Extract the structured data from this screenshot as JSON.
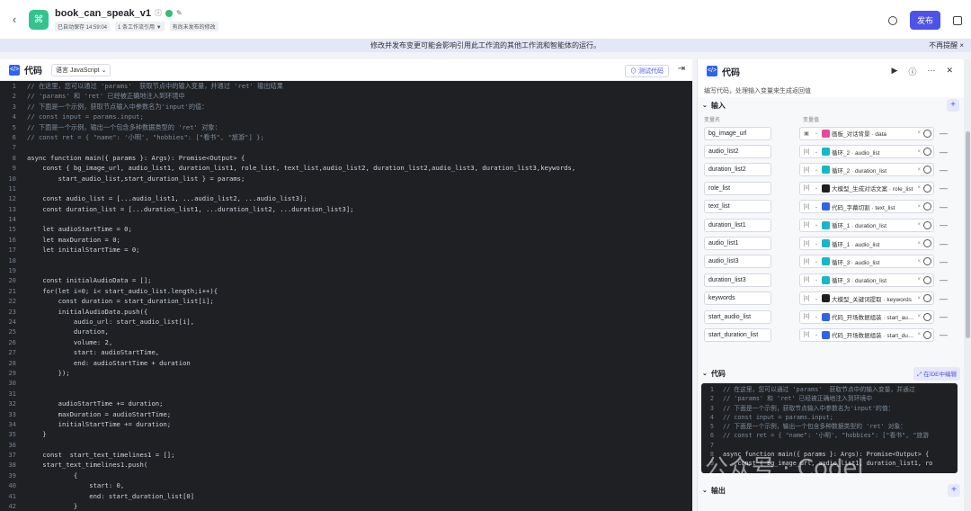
{
  "topbar": {
    "back_glyph": "‹",
    "title": "book_can_speak_v1",
    "autosave": "已自动保存 14:59:04",
    "refs": "1 条工作流引用 ▼",
    "unpublished": "有尚未发布的修改",
    "publish_label": "发布"
  },
  "notice": {
    "text": "修改并发布变更可能会影响引用此工作流的其他工作流和智能体的运行。",
    "dismiss": "不再提醒 ×"
  },
  "editor_panel": {
    "title": "代码",
    "language": "语言 JavaScript ⌄",
    "test_label": "⊙ 测试代码"
  },
  "code_lines": [
    {
      "n": "1",
      "t": "// 在这里，您可以通过 'params'  获取节点中的输入变量，并通过 'ret' 输出结果",
      "c": true
    },
    {
      "n": "2",
      "t": "// 'params' 和 'ret' 已经被正确地注入到环境中",
      "c": true
    },
    {
      "n": "3",
      "t": "// 下面是一个示例，获取节点输入中参数名为'input'的值：",
      "c": true
    },
    {
      "n": "4",
      "t": "// const input = params.input;",
      "c": true
    },
    {
      "n": "5",
      "t": "// 下面是一个示例，输出一个包含多种数据类型的 'ret' 对象：",
      "c": true
    },
    {
      "n": "6",
      "t": "// const ret = { \"name\": '小明', \"hobbies\": [\"看书\", \"旅游\"] };",
      "c": true
    },
    {
      "n": "7",
      "t": "",
      "c": false
    },
    {
      "n": "8",
      "t": "async function main({ params }: Args): Promise<Output> {",
      "c": false
    },
    {
      "n": "9",
      "t": "    const { bg_image_url, audio_list1, duration_list1, role_list, text_list,audio_list2, duration_list2,audio_list3, duration_list3,keywords,",
      "c": false
    },
    {
      "n": "10",
      "t": "        start_audio_list,start_duration_list } = params;",
      "c": false
    },
    {
      "n": "11",
      "t": "",
      "c": false
    },
    {
      "n": "12",
      "t": "    const audio_list = [...audio_list1, ...audio_list2, ...audio_list3];",
      "c": false
    },
    {
      "n": "13",
      "t": "    const duration_list = [...duration_list1, ...duration_list2, ...duration_list3];",
      "c": false
    },
    {
      "n": "14",
      "t": "",
      "c": false
    },
    {
      "n": "15",
      "t": "    let audioStartTime = 0;",
      "c": false
    },
    {
      "n": "16",
      "t": "    let maxDuration = 0;",
      "c": false
    },
    {
      "n": "17",
      "t": "    let initialStartTime = 0;",
      "c": false
    },
    {
      "n": "18",
      "t": "",
      "c": false
    },
    {
      "n": "19",
      "t": "",
      "c": false
    },
    {
      "n": "20",
      "t": "    const initialAudioData = [];",
      "c": false
    },
    {
      "n": "21",
      "t": "    for(let i=0; i< start_audio_list.length;i++){",
      "c": false
    },
    {
      "n": "22",
      "t": "        const duration = start_duration_list[i];",
      "c": false
    },
    {
      "n": "23",
      "t": "        initialAudioData.push({",
      "c": false
    },
    {
      "n": "24",
      "t": "            audio_url: start_audio_list[i],",
      "c": false
    },
    {
      "n": "25",
      "t": "            duration,",
      "c": false
    },
    {
      "n": "26",
      "t": "            volume: 2,",
      "c": false
    },
    {
      "n": "27",
      "t": "            start: audioStartTime,",
      "c": false
    },
    {
      "n": "28",
      "t": "            end: audioStartTime + duration",
      "c": false
    },
    {
      "n": "29",
      "t": "        });",
      "c": false
    },
    {
      "n": "30",
      "t": "",
      "c": false
    },
    {
      "n": "31",
      "t": "",
      "c": false
    },
    {
      "n": "32",
      "t": "        audioStartTime += duration;",
      "c": false
    },
    {
      "n": "33",
      "t": "        maxDuration = audioStartTime;",
      "c": false
    },
    {
      "n": "34",
      "t": "        initialStartTime += duration;",
      "c": false
    },
    {
      "n": "35",
      "t": "    }",
      "c": false
    },
    {
      "n": "36",
      "t": "",
      "c": false
    },
    {
      "n": "37",
      "t": "    const  start_text_timelines1 = [];",
      "c": false
    },
    {
      "n": "38",
      "t": "    start_text_timelines1.push(",
      "c": false
    },
    {
      "n": "39",
      "t": "            {",
      "c": false
    },
    {
      "n": "40",
      "t": "                start: 0,",
      "c": false
    },
    {
      "n": "41",
      "t": "                end: start_duration_list[0]",
      "c": false
    },
    {
      "n": "42",
      "t": "            }",
      "c": false
    }
  ],
  "side_panel": {
    "title": "代码",
    "description": "编写代码，处理输入变量来生成返回值",
    "input_title": "输入",
    "col_name": "变量名",
    "col_value": "变量值",
    "code_title": "代码",
    "ide_label": "⤢ 在IDE中编辑",
    "output_title": "输出"
  },
  "inputs": [
    {
      "name": "bg_image_url",
      "type": "▣",
      "icon_color": "#e8489a",
      "ref": "画板_对话背景 · data"
    },
    {
      "name": "audio_list2",
      "type": "[≡]",
      "icon_color": "#15b8c6",
      "ref": "循环_2 · audio_list"
    },
    {
      "name": "duration_list2",
      "type": "[≡]",
      "icon_color": "#15b8c6",
      "ref": "循环_2 · duration_list"
    },
    {
      "name": "role_list",
      "type": "[≡]",
      "icon_color": "#1f1f1f",
      "ref": "大模型_生成对话文案 · role_list"
    },
    {
      "name": "text_list",
      "type": "[≡]",
      "icon_color": "#2f64e8",
      "ref": "代码_字幕切割 · text_list"
    },
    {
      "name": "duration_list1",
      "type": "[≡]",
      "icon_color": "#15b8c6",
      "ref": "循环_1 · duration_list"
    },
    {
      "name": "audio_list1",
      "type": "[≡]",
      "icon_color": "#15b8c6",
      "ref": "循环_1 · audio_list"
    },
    {
      "name": "audio_list3",
      "type": "[≡]",
      "icon_color": "#15b8c6",
      "ref": "循环_3 · audio_list"
    },
    {
      "name": "duration_list3",
      "type": "[≡]",
      "icon_color": "#15b8c6",
      "ref": "循环_3 · duration_list"
    },
    {
      "name": "keywords",
      "type": "[≡]",
      "icon_color": "#1f1f1f",
      "ref": "大模型_关键词提取 · keywords"
    },
    {
      "name": "start_audio_list",
      "type": "[≡]",
      "icon_color": "#2f64e8",
      "ref": "代码_开场数据组装 · start_aud···"
    },
    {
      "name": "start_duration_list",
      "type": "[≡]",
      "icon_color": "#2f64e8",
      "ref": "代码_开场数据组装 · start_dur···"
    }
  ],
  "mini_code": [
    {
      "n": "1",
      "t": "// 在这里，您可以通过 'params'  获取节点中的输入变量，并通过",
      "c": true
    },
    {
      "n": "2",
      "t": "// 'params' 和 'ret' 已经被正确地注入到环境中",
      "c": true
    },
    {
      "n": "3",
      "t": "// 下面是一个示例，获取节点输入中参数名为'input'的值：",
      "c": true
    },
    {
      "n": "4",
      "t": "// const input = params.input;",
      "c": true
    },
    {
      "n": "5",
      "t": "// 下面是一个示例，输出一个包含多种数据类型的 'ret' 对象：",
      "c": true
    },
    {
      "n": "6",
      "t": "// const ret = { \"name\": '小明', \"hobbies\": [\"看书\", \"旅游",
      "c": true
    },
    {
      "n": "7",
      "t": "",
      "c": false
    },
    {
      "n": "8",
      "t": "async function main({ params }: Args): Promise<Output> {",
      "c": false
    },
    {
      "n": "9",
      "t": "    const { bg_image_url, audio_list1, duration_list1, ro",
      "c": false
    }
  ],
  "watermark": "公众号 · Codel",
  "colors": {
    "accent": "#4d53e8",
    "editor_bg": "#1e2024"
  }
}
